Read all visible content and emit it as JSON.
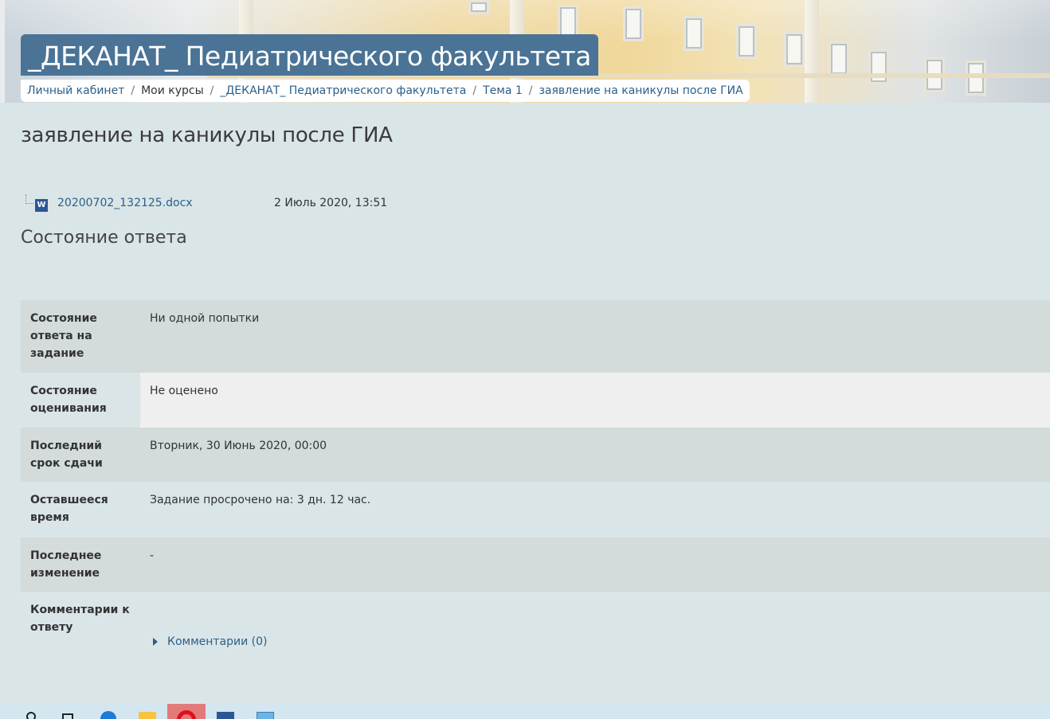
{
  "header": {
    "course_title": "_ДЕКАНАТ_ Педиатрического факультета",
    "breadcrumb": [
      {
        "label": "Личный кабинет",
        "link": true
      },
      {
        "label": "Мои курсы",
        "link": false
      },
      {
        "label": "_ДЕКАНАТ_ Педиатрического факультета",
        "link": true
      },
      {
        "label": "Тема 1",
        "link": true
      },
      {
        "label": "заявление на каникулы после ГИА",
        "link": true
      }
    ]
  },
  "main": {
    "heading": "заявление на каникулы после ГИА",
    "attachment": {
      "icon": "word-document-icon",
      "icon_letter": "W",
      "file_name": "20200702_132125.docx",
      "date": "2 Июль 2020, 13:51"
    },
    "section_heading": "Состояние ответа",
    "status_rows": [
      {
        "label": "Состояние ответа на задание",
        "value": "Ни одной попытки"
      },
      {
        "label": "Состояние оценивания",
        "value": "Не оценено"
      },
      {
        "label": "Последний срок сдачи",
        "value": "Вторник, 30 Июнь 2020, 00:00"
      },
      {
        "label": "Оставшееся время",
        "value": "Задание просрочено на: 3 дн. 12 час."
      },
      {
        "label": "Последнее изменение",
        "value": "-"
      },
      {
        "label": "Комментарии к ответу",
        "value": "Комментарии (0)"
      }
    ],
    "overdue_color": "#e60000"
  },
  "taskbar": {
    "icons": [
      "search-icon",
      "task-view-icon",
      "edge-icon",
      "file-explorer-icon",
      "opera-icon",
      "word-icon",
      "app-icon"
    ]
  }
}
